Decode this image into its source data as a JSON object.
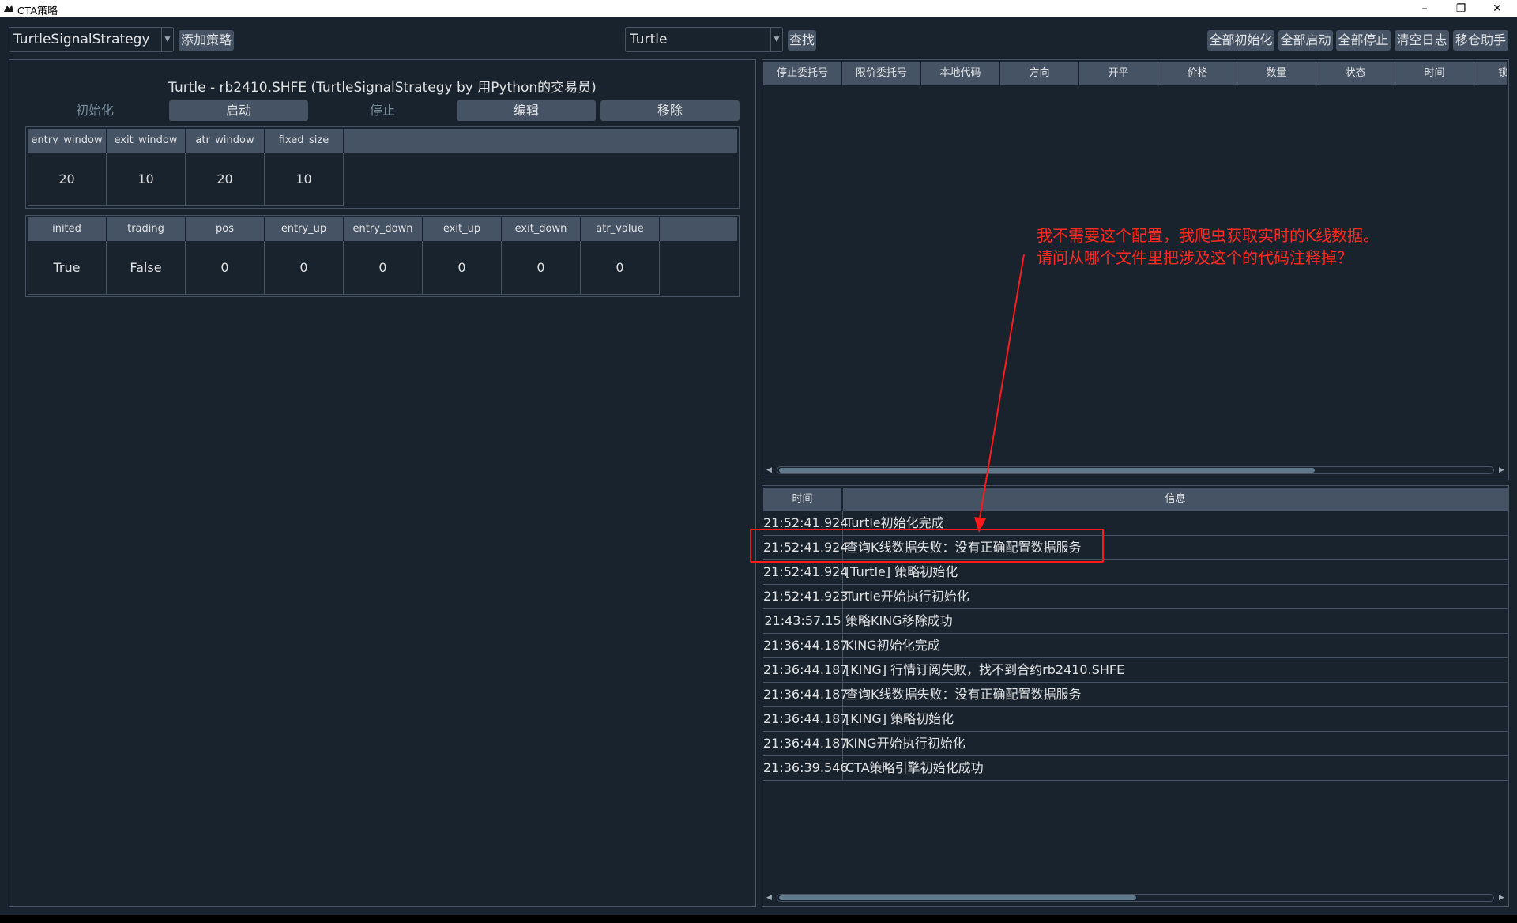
{
  "window": {
    "title": "CTA策略",
    "controls": {
      "minimize": "–",
      "restore": "❐",
      "close": "✕"
    }
  },
  "toolbar": {
    "class_combo_value": "TurtleSignalStrategy",
    "add_strategy_label": "添加策略",
    "search_combo_value": "Turtle",
    "find_label": "查找",
    "init_all_label": "全部初始化",
    "start_all_label": "全部启动",
    "stop_all_label": "全部停止",
    "clear_log_label": "清空日志",
    "rollover_label": "移仓助手"
  },
  "strategy": {
    "title": "Turtle  -  rb2410.SHFE  (TurtleSignalStrategy by 用Python的交易员)",
    "buttons": {
      "init": "初始化",
      "start": "启动",
      "stop": "停止",
      "edit": "编辑",
      "remove": "移除"
    },
    "params": {
      "headers": [
        "entry_window",
        "exit_window",
        "atr_window",
        "fixed_size"
      ],
      "values": [
        "20",
        "10",
        "20",
        "10"
      ]
    },
    "variables": {
      "headers": [
        "inited",
        "trading",
        "pos",
        "entry_up",
        "entry_down",
        "exit_up",
        "exit_down",
        "atr_value"
      ],
      "values": [
        "True",
        "False",
        "0",
        "0",
        "0",
        "0",
        "0",
        "0"
      ]
    }
  },
  "stop_orders": {
    "headers": [
      "停止委托号",
      "限价委托号",
      "本地代码",
      "方向",
      "开平",
      "价格",
      "数量",
      "状态",
      "时间",
      "锁"
    ],
    "scroll_position": 0.75
  },
  "log": {
    "headers": {
      "time": "时间",
      "msg": "信息"
    },
    "rows": [
      {
        "time": "21:52:41.924",
        "msg": "Turtle初始化完成"
      },
      {
        "time": "21:52:41.924",
        "msg": "查询K线数据失败：没有正确配置数据服务"
      },
      {
        "time": "21:52:41.924",
        "msg": "[Turtle]  策略初始化"
      },
      {
        "time": "21:52:41.923",
        "msg": "Turtle开始执行初始化"
      },
      {
        "time": "21:43:57.15",
        "msg": "策略KING移除成功"
      },
      {
        "time": "21:36:44.187",
        "msg": "KING初始化完成"
      },
      {
        "time": "21:36:44.187",
        "msg": "[KING]  行情订阅失败，找不到合约rb2410.SHFE"
      },
      {
        "time": "21:36:44.187",
        "msg": "查询K线数据失败：没有正确配置数据服务"
      },
      {
        "time": "21:36:44.187",
        "msg": "[KING]  策略初始化"
      },
      {
        "time": "21:36:44.187",
        "msg": "KING开始执行初始化"
      },
      {
        "time": "21:36:39.546",
        "msg": "CTA策略引擎初始化成功"
      }
    ],
    "scroll_position": 0.5
  },
  "annotation": {
    "line1": "我不需要这个配置，我爬虫获取实时的K线数据。",
    "line2": "请问从哪个文件里把涉及这个的代码注释掉？",
    "color": "#ff2a1f"
  },
  "colors": {
    "background": "#19232d",
    "header": "#455364",
    "text": "#e0e1e3",
    "disabled": "#788d9c"
  }
}
